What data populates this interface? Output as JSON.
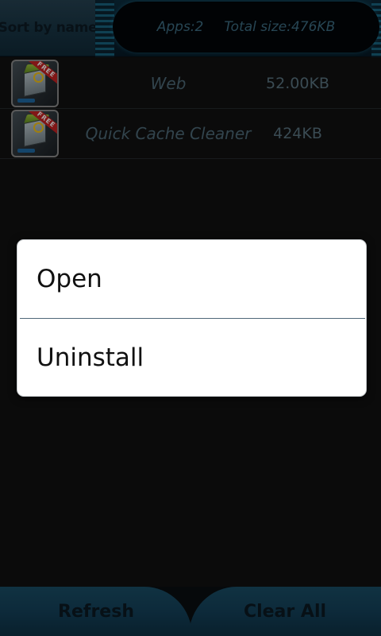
{
  "header": {
    "sort_label": "Sort by name",
    "apps_count": "Apps:2",
    "total_size": "Total size:476KB"
  },
  "apps": [
    {
      "name": "Web",
      "size": "52.00KB",
      "icon": "app-box-icon",
      "badge": "FREE"
    },
    {
      "name": "Quick Cache Cleaner",
      "size": "424KB",
      "icon": "app-box-icon",
      "badge": "FREE"
    }
  ],
  "context_menu": {
    "items": [
      {
        "label": "Open"
      },
      {
        "label": "Uninstall"
      }
    ]
  },
  "footer": {
    "refresh_label": "Refresh",
    "clear_all_label": "Clear All"
  },
  "colors": {
    "accent": "#1b6f8c",
    "header_bg": "#0a2434",
    "button_bg": "#14415a",
    "list_text": "#4d6977",
    "dialog_bg": "#ffffff"
  }
}
